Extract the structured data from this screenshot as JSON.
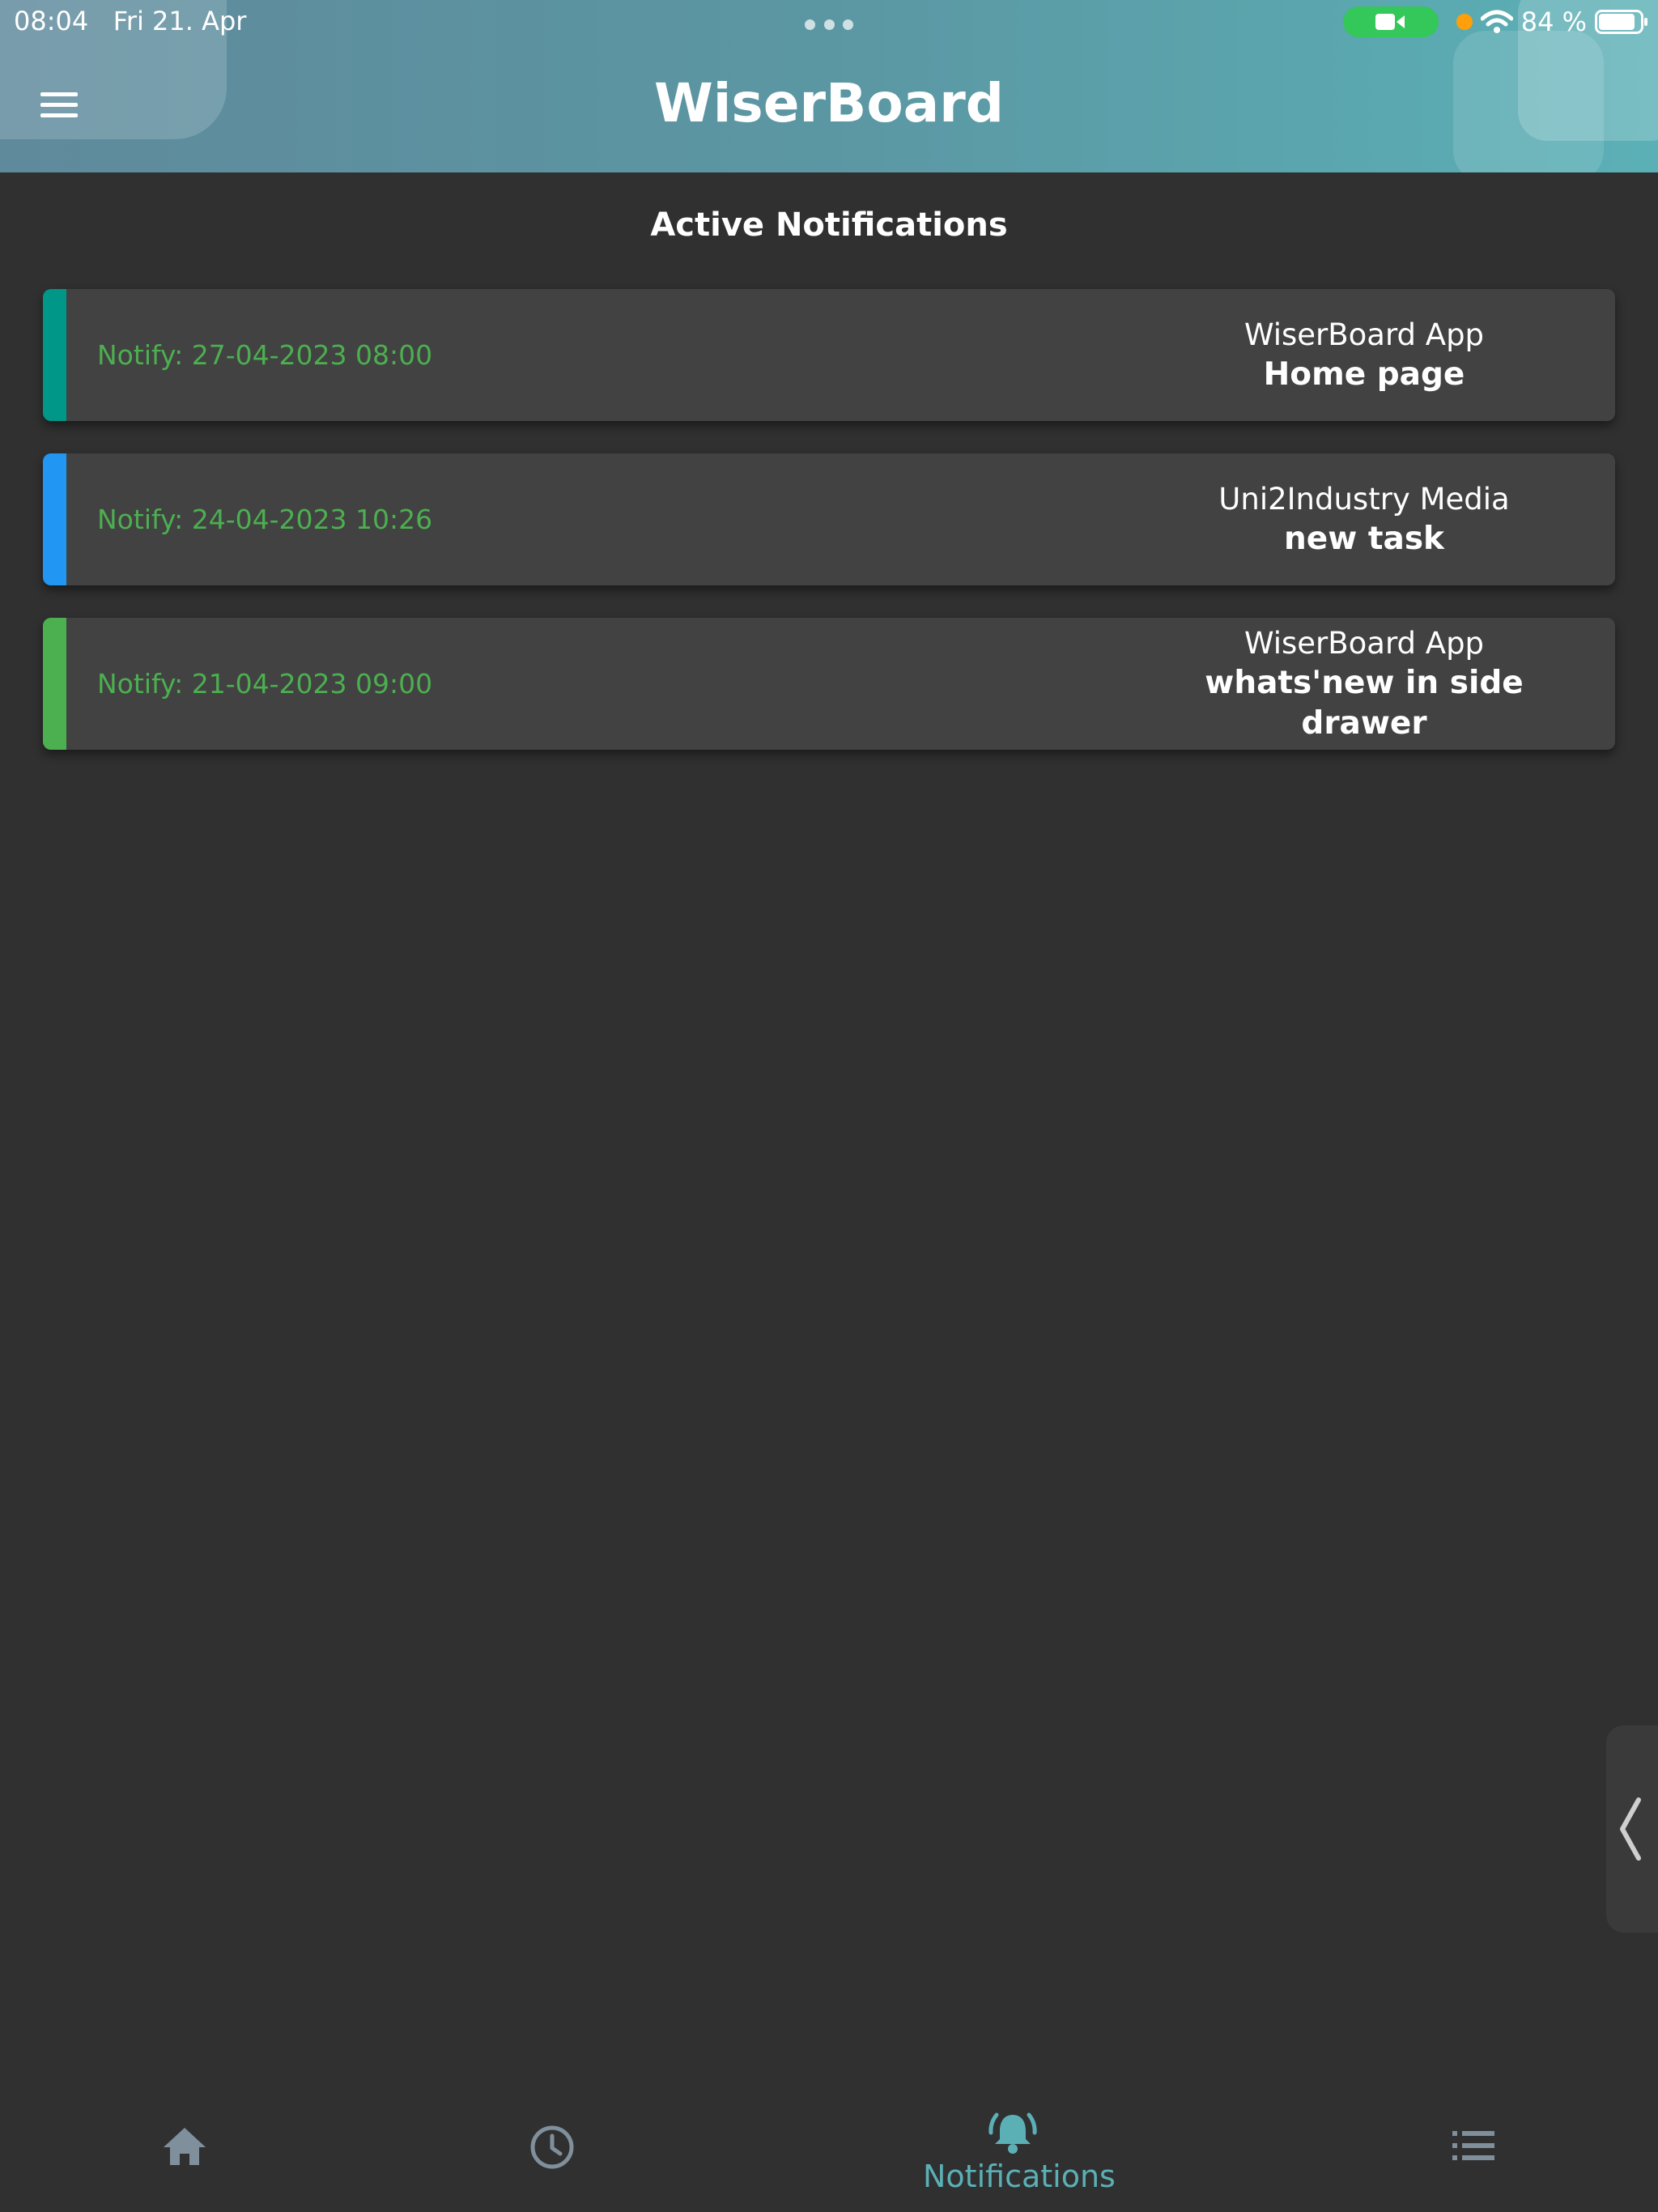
{
  "status_bar": {
    "time": "08:04",
    "date": "Fri 21. Apr",
    "battery": "84 %"
  },
  "app_bar": {
    "title": "WiserBoard",
    "menu_icon": "hamburger-menu-icon"
  },
  "page": {
    "section_title": "Active Notifications"
  },
  "notifications": [
    {
      "notify": "Notify: 27-04-2023 08:00",
      "source": "WiserBoard App",
      "subject": "Home page",
      "accent": "#009688"
    },
    {
      "notify": "Notify: 24-04-2023 10:26",
      "source": "Uni2Industry Media",
      "subject": "new task",
      "accent": "#2196f3"
    },
    {
      "notify": "Notify: 21-04-2023 09:00",
      "source": "WiserBoard App",
      "subject": "whats'new in side drawer",
      "accent": "#4caf50"
    }
  ],
  "bottom_nav": {
    "items": [
      {
        "icon": "home-icon",
        "label": "",
        "active": false
      },
      {
        "icon": "clock-icon",
        "label": "",
        "active": false
      },
      {
        "icon": "bell-ringing-icon",
        "label": "Notifications",
        "active": true
      },
      {
        "icon": "list-icon",
        "label": "",
        "active": false
      }
    ]
  },
  "colors": {
    "header_start": "#5f8a9c",
    "header_end": "#5bb0b6",
    "background": "#303030",
    "card": "#424242",
    "notify_text": "#4caf50",
    "nav_active": "#5bb0b6",
    "nav_inactive": "#7f8f9c"
  }
}
